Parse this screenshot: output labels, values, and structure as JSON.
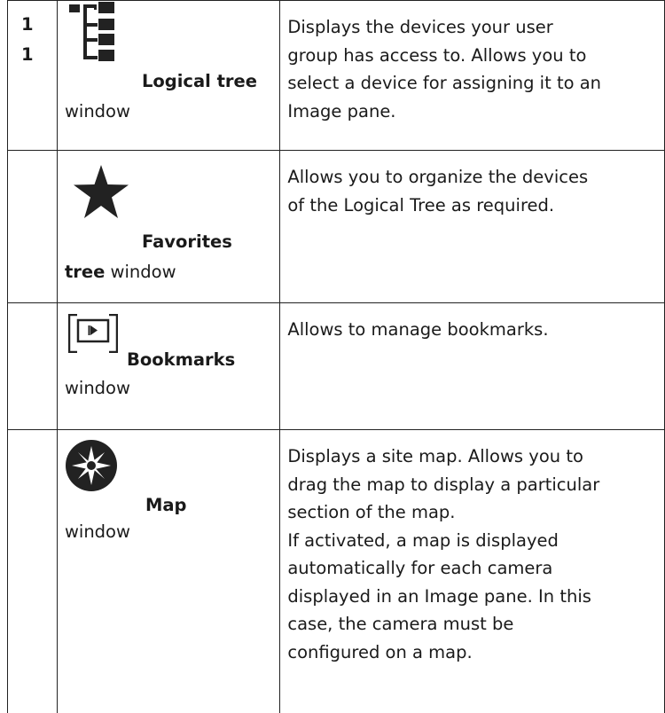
{
  "rows": [
    {
      "number_lines": [
        "1",
        "1"
      ],
      "icon": "logical-tree-icon",
      "name": "Logical tree",
      "suffix": "window",
      "description": [
        "Displays the devices your user",
        "group has access to. Allows you to",
        "select a device for assigning it to an",
        "Image pane."
      ]
    },
    {
      "icon": "star-icon",
      "name_line1": "Favorites",
      "name_line2": "tree",
      "suffix": "window",
      "description": [
        "Allows you to organize the devices",
        "of the Logical Tree as required."
      ]
    },
    {
      "icon": "bookmark-icon",
      "name": "Bookmarks",
      "suffix": "window",
      "description": [
        "Allows to manage bookmarks."
      ]
    },
    {
      "icon": "compass-map-icon",
      "name": "Map",
      "suffix": "window",
      "description": [
        "Displays a site map. Allows you to",
        "drag the map to display a particular",
        "section of the map.",
        "If activated, a map is displayed",
        "automatically for each camera",
        "displayed in an Image pane. In this",
        "case, the camera must be",
        "configured on a map."
      ]
    }
  ]
}
